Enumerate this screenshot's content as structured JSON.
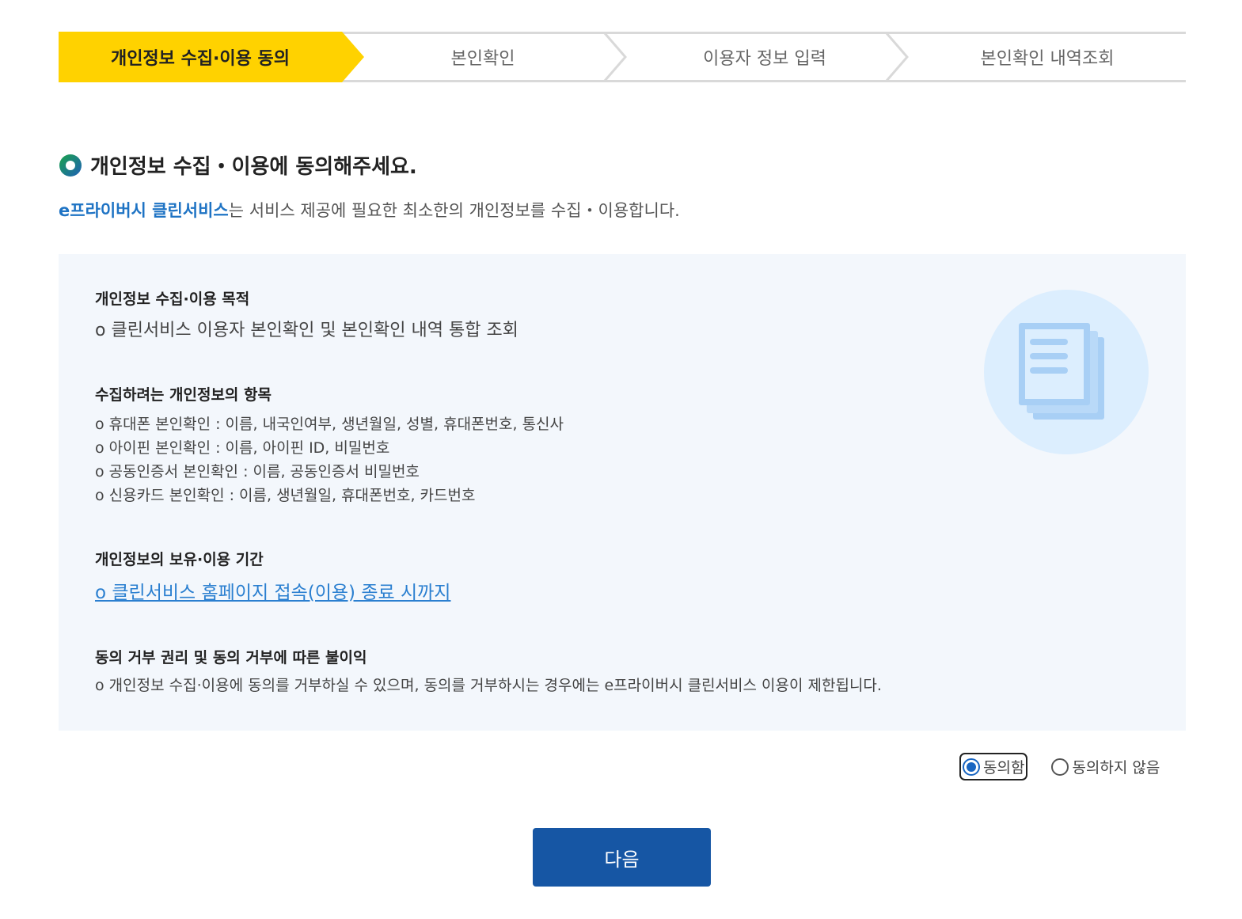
{
  "steps": [
    {
      "label": "개인정보 수집·이용 동의",
      "active": true
    },
    {
      "label": "본인확인",
      "active": false
    },
    {
      "label": "이용자 정보 입력",
      "active": false
    },
    {
      "label": "본인확인 내역조회",
      "active": false
    }
  ],
  "heading": "개인정보 수집・이용에 동의해주세요.",
  "intro": {
    "brand": "e프라이버시 클린서비스",
    "text": "는 서비스 제공에 필요한 최소한의 개인정보를 수집・이용합니다."
  },
  "sections": {
    "purpose": {
      "title": "개인정보 수집·이용 목적",
      "line": "o 클린서비스 이용자 본인확인 및 본인확인 내역 통합 조회"
    },
    "items": {
      "title": "수집하려는 개인정보의 항목",
      "lines": [
        "o 휴대폰 본인확인 : 이름, 내국인여부, 생년월일, 성별, 휴대폰번호, 통신사",
        "o 아이핀 본인확인 : 이름, 아이핀 ID, 비밀번호",
        "o 공동인증서 본인확인 : 이름, 공동인증서 비밀번호",
        "o 신용카드 본인확인 : 이름, 생년월일, 휴대폰번호, 카드번호"
      ]
    },
    "period": {
      "title": "개인정보의 보유·이용 기간",
      "link": "o 클린서비스 홈페이지 접속(이용) 종료 시까지"
    },
    "refusal": {
      "title": "동의 거부 권리 및 동의 거부에 따른 불이익",
      "line": "o 개인정보 수집·이용에 동의를 거부하실 수 있으며, 동의를 거부하시는 경우에는 e프라이버시 클린서비스 이용이 제한됩니다."
    }
  },
  "consent": {
    "agree_label": "동의함",
    "disagree_label": "동의하지 않음",
    "selected": "agree"
  },
  "next_button": "다음",
  "colors": {
    "active_step": "#ffd200",
    "brand_blue": "#1e73c4",
    "button_blue": "#1656a4",
    "info_bg": "#f3f7fc"
  }
}
